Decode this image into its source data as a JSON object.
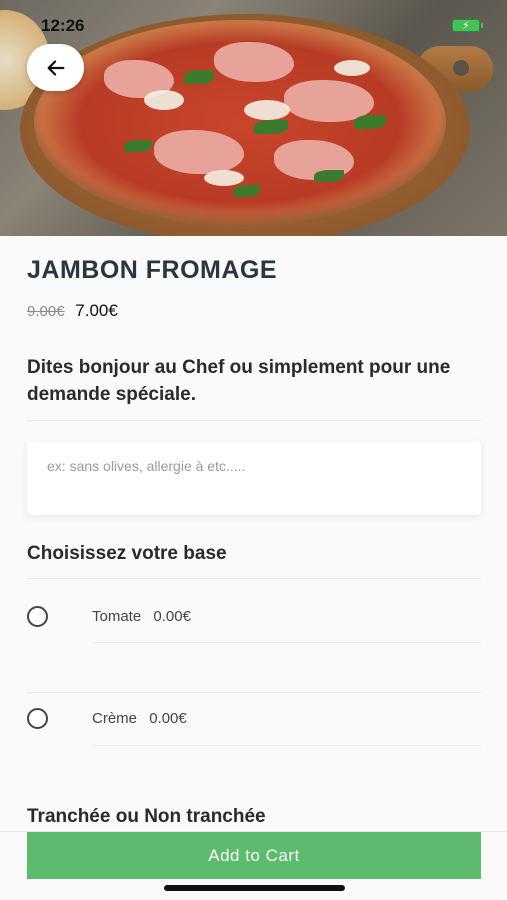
{
  "status_bar": {
    "time": "12:26"
  },
  "product": {
    "name": "JAMBON FROMAGE",
    "old_price": "9.00€",
    "price": "7.00€"
  },
  "chef_message": "Dites bonjour au Chef ou simplement pour une demande spéciale.",
  "note": {
    "placeholder": "ex: sans olives, allergie à etc....."
  },
  "base_section": {
    "title": "Choisissez votre base",
    "options": [
      {
        "label": "Tomate",
        "price": "0.00€",
        "selected": false
      },
      {
        "label": "Crème",
        "price": "0.00€",
        "selected": false
      }
    ]
  },
  "slice_section": {
    "title": "Tranchée ou Non tranchée"
  },
  "footer": {
    "add_to_cart_label": "Add to Cart"
  },
  "colors": {
    "accent": "#5cbb6c",
    "battery": "#46c158",
    "title": "#2c3440"
  },
  "icons": {
    "back": "arrow-left-icon",
    "battery": "battery-charging-icon"
  }
}
